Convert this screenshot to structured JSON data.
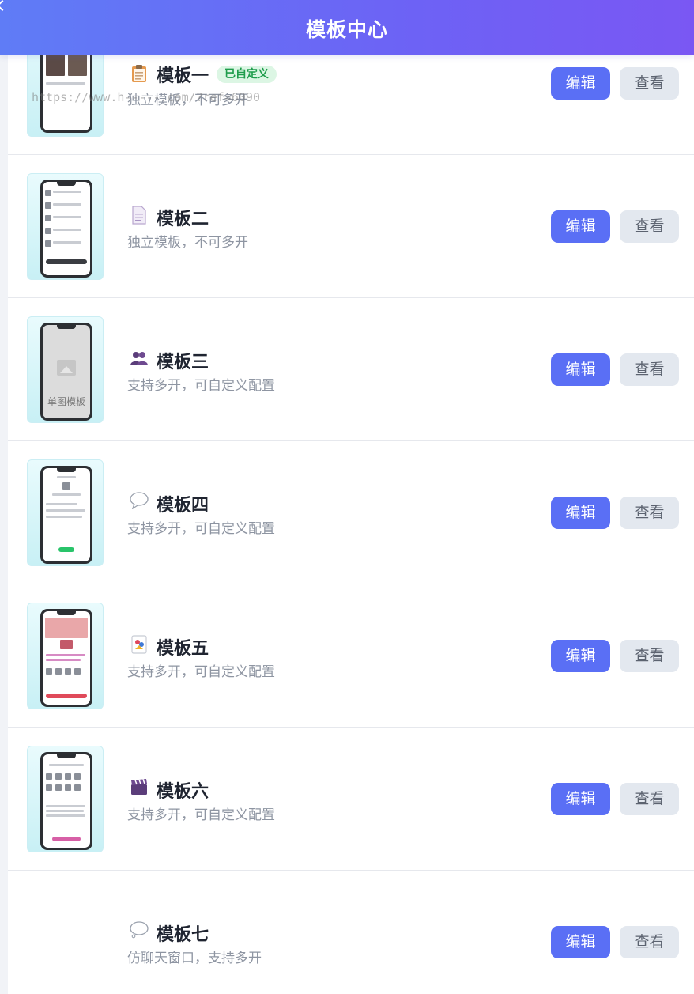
{
  "header": {
    "title": "模板中心"
  },
  "watermark": "https://www.h-----.com/?ref=6090",
  "templates": [
    {
      "name": "模板一",
      "desc": "独立模板，不可多开",
      "badge": "已自定义",
      "icon": "clipboard-icon",
      "edit": "编辑",
      "view": "查看"
    },
    {
      "name": "模板二",
      "desc": "独立模板，不可多开",
      "badge": "",
      "icon": "document-icon",
      "edit": "编辑",
      "view": "查看"
    },
    {
      "name": "模板三",
      "desc": "支持多开，可自定义配置",
      "badge": "",
      "icon": "users-icon",
      "edit": "编辑",
      "view": "查看",
      "thumb_label": "单图模板"
    },
    {
      "name": "模板四",
      "desc": "支持多开，可自定义配置",
      "badge": "",
      "icon": "speech-bubble-icon",
      "edit": "编辑",
      "view": "查看"
    },
    {
      "name": "模板五",
      "desc": "支持多开，可自定义配置",
      "badge": "",
      "icon": "joker-card-icon",
      "edit": "编辑",
      "view": "查看"
    },
    {
      "name": "模板六",
      "desc": "支持多开，可自定义配置",
      "badge": "",
      "icon": "clapper-board-icon",
      "edit": "编辑",
      "view": "查看"
    },
    {
      "name": "模板七",
      "desc": "仿聊天窗口，支持多开",
      "badge": "",
      "icon": "thought-bubble-icon",
      "edit": "编辑",
      "view": "查看"
    }
  ],
  "colors": {
    "header_start": "#5f7cf6",
    "header_end": "#7a57f3",
    "edit_button": "#5a6ff5",
    "view_button": "#e3e8ef",
    "badge_bg": "#dcf6e4",
    "badge_text": "#1f9d4c"
  }
}
